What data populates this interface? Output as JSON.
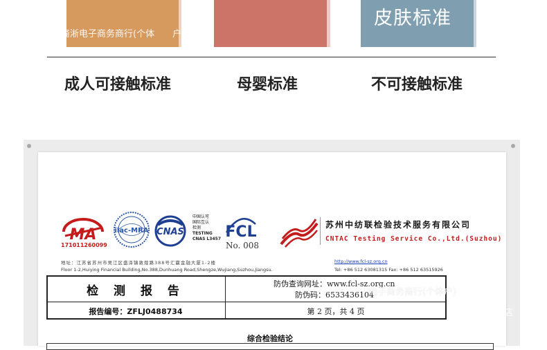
{
  "banner": {
    "swatch_text": "皮肤标准",
    "watermark_top": "裔淅电子商务商行(个体",
    "watermark_tail": "户)"
  },
  "categories": [
    {
      "label": "成人可接触标准"
    },
    {
      "label": "母婴标准"
    },
    {
      "label": "不可接触标准"
    }
  ],
  "logos": {
    "ma_number": "171011260099",
    "ilac_text": "ilac-MRA",
    "cnas_text": "CNAS",
    "cnas_lines": [
      "中国认可",
      "国际互认",
      "检测",
      "TESTING",
      "CNAS L3457"
    ],
    "fcl_text": "FCL",
    "fcl_no": "No. 008"
  },
  "company": {
    "name_cn": "苏州中纺联检验技术服务有限公司",
    "name_en": "CNTAC Testing Service Co.,Ltd.(Suzhou)",
    "address_cn": "地址：江苏省苏州市吴江区盛泽镇敦煌路388号汇赢金融大厦1-2楼",
    "address_en": "Floor 1-2,Huiying Financial Building,No.388,Dunhuang Road,Shengze,Wujiang,Suzhou,Jiangsu.",
    "url": "http://www.fcl-sz.org.cn",
    "tel": "Tel: +86 512 63081315    Fax: +86 512 63515926"
  },
  "report": {
    "title": "检 测 报 告",
    "number": "报告编号：ZFLJ0488734",
    "query_site": "防伪查询网址：www.fcl-sz.org.cn",
    "anti_code": "防伪码：6533436104",
    "page": "第 2 页，共 4 页",
    "watermark_mid": "电子商务商行(个体户)",
    "watermark_dian": "店",
    "conclusion": "综合检验结论"
  }
}
